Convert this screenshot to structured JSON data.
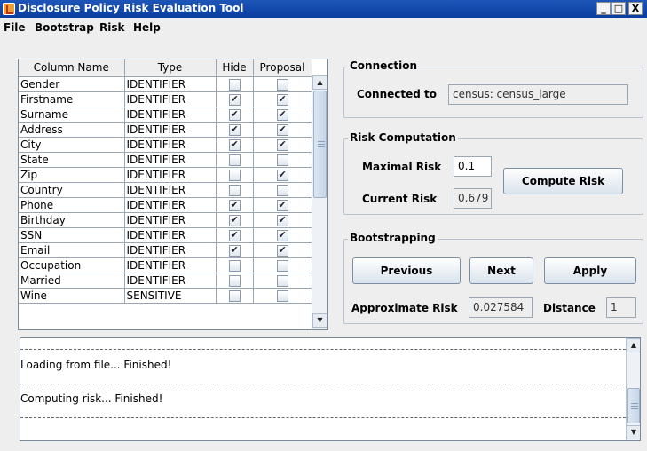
{
  "window": {
    "title": "Disclosure Policy Risk Evaluation Tool",
    "minimize": "_",
    "maximize": "□",
    "close": "X"
  },
  "menu": {
    "file": "File",
    "bootstrap": "Bootstrap",
    "risk": "Risk",
    "help": "Help"
  },
  "table": {
    "headers": [
      "Column Name",
      "Type",
      "Hide",
      "Proposal"
    ],
    "rows": [
      {
        "name": "Gender",
        "type": "IDENTIFIER",
        "hide": false,
        "proposal": false
      },
      {
        "name": "Firstname",
        "type": "IDENTIFIER",
        "hide": true,
        "proposal": true
      },
      {
        "name": "Surname",
        "type": "IDENTIFIER",
        "hide": true,
        "proposal": true
      },
      {
        "name": "Address",
        "type": "IDENTIFIER",
        "hide": true,
        "proposal": true
      },
      {
        "name": "City",
        "type": "IDENTIFIER",
        "hide": true,
        "proposal": true
      },
      {
        "name": "State",
        "type": "IDENTIFIER",
        "hide": false,
        "proposal": false
      },
      {
        "name": "Zip",
        "type": "IDENTIFIER",
        "hide": false,
        "proposal": true
      },
      {
        "name": "Country",
        "type": "IDENTIFIER",
        "hide": false,
        "proposal": false
      },
      {
        "name": "Phone",
        "type": "IDENTIFIER",
        "hide": true,
        "proposal": true
      },
      {
        "name": "Birthday",
        "type": "IDENTIFIER",
        "hide": true,
        "proposal": true
      },
      {
        "name": "SSN",
        "type": "IDENTIFIER",
        "hide": true,
        "proposal": true
      },
      {
        "name": "Email",
        "type": "IDENTIFIER",
        "hide": true,
        "proposal": true
      },
      {
        "name": "Occupation",
        "type": "IDENTIFIER",
        "hide": false,
        "proposal": false
      },
      {
        "name": "Married",
        "type": "IDENTIFIER",
        "hide": false,
        "proposal": false
      },
      {
        "name": "Wine",
        "type": "SENSITIVE",
        "hide": false,
        "proposal": false
      }
    ]
  },
  "connection": {
    "group_title": "Connection",
    "label": "Connected to",
    "value": "census: census_large"
  },
  "risk": {
    "group_title": "Risk Computation",
    "maximal_label": "Maximal Risk",
    "maximal_value": "0.1",
    "current_label": "Current Risk",
    "current_value": "0.679",
    "compute_button": "Compute Risk"
  },
  "bootstrapping": {
    "group_title": "Bootstrapping",
    "previous_button": "Previous",
    "next_button": "Next",
    "apply_button": "Apply",
    "approx_label": "Approximate Risk",
    "approx_value": "0.027584",
    "distance_label": "Distance",
    "distance_value": "1"
  },
  "log": {
    "lines": [
      "Loading from file... Finished!",
      "Computing risk... Finished!"
    ]
  },
  "colors": {
    "titlebar": "#0a3da0",
    "window_bg": "#eeeeee"
  }
}
